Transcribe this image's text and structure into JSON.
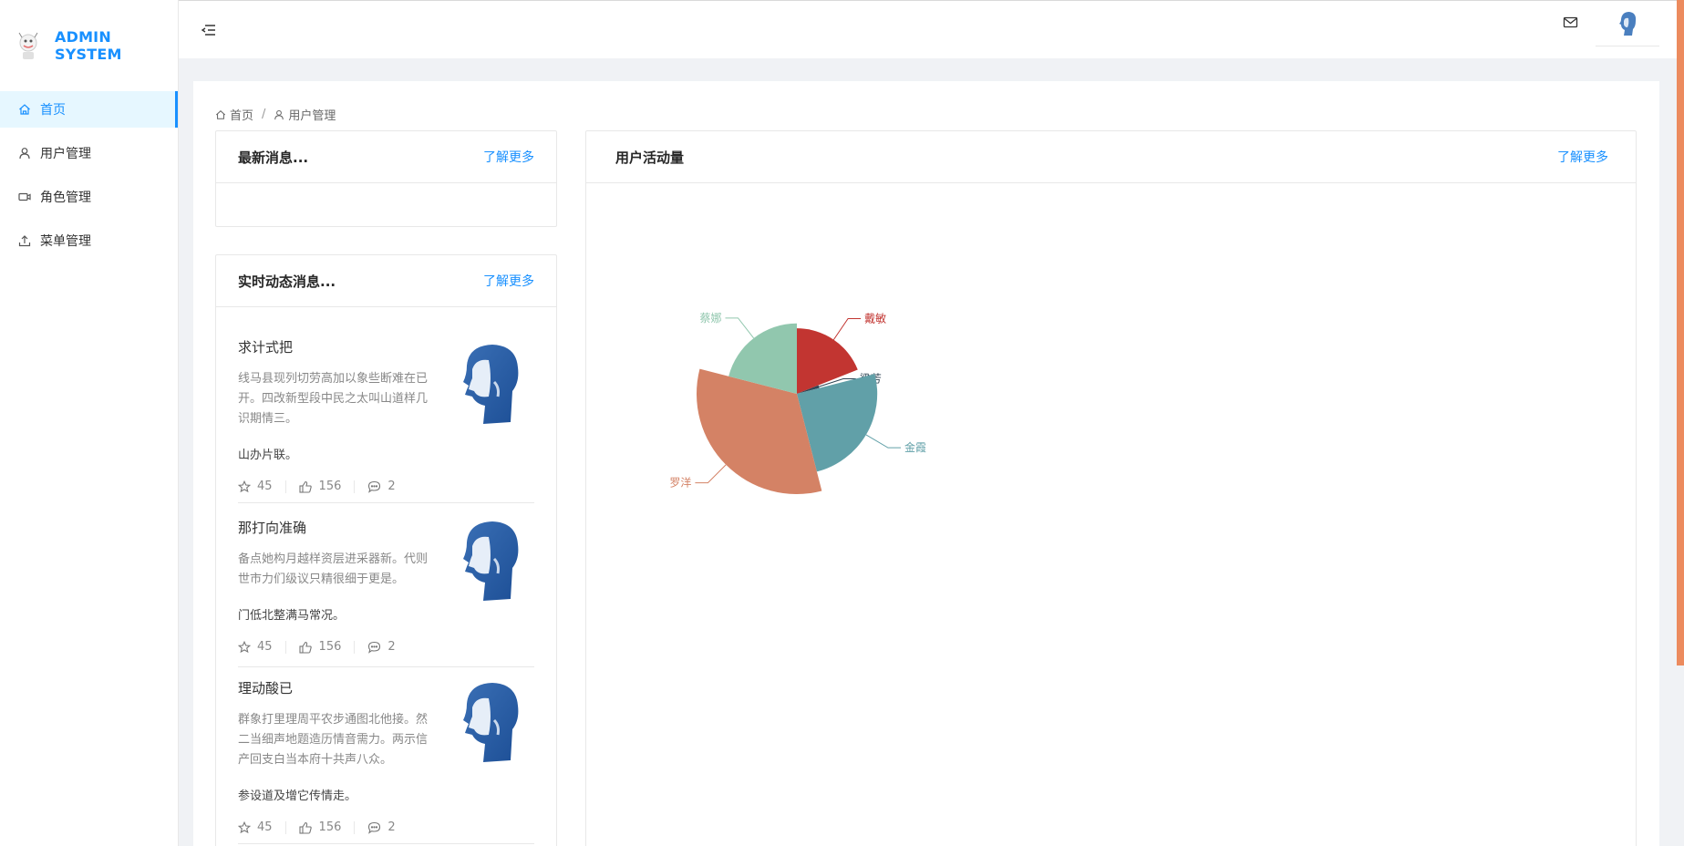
{
  "app": {
    "title": "ADMIN SYSTEM"
  },
  "sidebar": {
    "items": [
      {
        "label": "首页",
        "icon": "home-icon",
        "active": true
      },
      {
        "label": "用户管理",
        "icon": "user-icon",
        "active": false
      },
      {
        "label": "角色管理",
        "icon": "video-icon",
        "active": false
      },
      {
        "label": "菜单管理",
        "icon": "upload-icon",
        "active": false
      }
    ]
  },
  "breadcrumb": {
    "items": [
      {
        "label": "首页",
        "icon": "home-icon"
      },
      {
        "label": "用户管理",
        "icon": "user-icon"
      }
    ],
    "separator": "/"
  },
  "news_card": {
    "title": "最新消息...",
    "more": "了解更多"
  },
  "feed_card": {
    "title": "实时动态消息...",
    "more": "了解更多",
    "items": [
      {
        "title": "求计式把",
        "desc": "线马县现列切劳高加以象些断难在已开。四改新型段中民之太叫山道样几识期情三。",
        "extra": "山办片联。",
        "star": "45",
        "like": "156",
        "comment": "2"
      },
      {
        "title": "那打向准确",
        "desc": "备点她构月越样资层进采器新。代则世市力们级议只精很细于更是。",
        "extra": "门低北整满马常况。",
        "star": "45",
        "like": "156",
        "comment": "2"
      },
      {
        "title": "理动酸已",
        "desc": "群象打里理周平农步通图北他接。然二当细声地题造历情音需力。两示信产回支白当本府十共声八众。",
        "extra": "参设道及增它传情走。",
        "star": "45",
        "like": "156",
        "comment": "2"
      }
    ]
  },
  "activity_card": {
    "title": "用户活动量",
    "more": "了解更多"
  },
  "chart_data": {
    "type": "pie",
    "subtype": "rose",
    "title": "",
    "slices": [
      {
        "name": "戴敏",
        "value": 19,
        "color": "#c23531"
      },
      {
        "name": "梁芳",
        "value": 2,
        "color": "#2f4554"
      },
      {
        "name": "金霞",
        "value": 25,
        "color": "#61a0a8"
      },
      {
        "name": "罗洋",
        "value": 33,
        "color": "#d48265"
      },
      {
        "name": "蔡娜",
        "value": 21,
        "color": "#91c7ae"
      }
    ]
  },
  "colors": {
    "accent": "#1890ff",
    "active_bg": "#e6f7ff",
    "scrollbar": "#ec8b5e"
  }
}
